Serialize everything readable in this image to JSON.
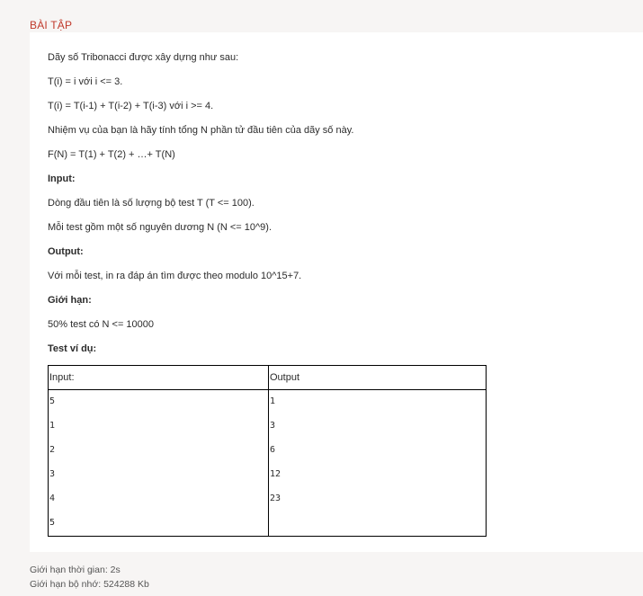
{
  "section_title": "BÀI TẬP",
  "problem": {
    "intro": "Dãy số Tribonacci được xây dựng như sau:",
    "rule1": "T(i) = i với i <= 3.",
    "rule2": "T(i) = T(i-1) + T(i-2) + T(i-3) với i >= 4.",
    "task": "Nhiệm vụ của bạn là hãy tính tổng N phần tử đầu tiên của dãy số này.",
    "formula": "F(N) = T(1) + T(2) + …+ T(N)",
    "input_heading": "Input:",
    "input_line1": "Dòng đầu tiên là số lượng bộ test T (T <= 100).",
    "input_line2": "Mỗi test gồm một số nguyên dương N (N <= 10^9).",
    "output_heading": "Output:",
    "output_line1": "Với mỗi test, in ra đáp án tìm được theo modulo 10^15+7.",
    "limit_heading": "Giới hạn:",
    "limit_line1": "50% test có N <= 10000",
    "example_heading": "Test ví dụ:",
    "example_table": {
      "header": [
        "Input:",
        "Output"
      ],
      "rows": [
        [
          "5",
          "1"
        ],
        [
          "1",
          "3"
        ],
        [
          "2",
          "6"
        ],
        [
          "3",
          "12"
        ],
        [
          "4",
          "23"
        ],
        [
          "5",
          ""
        ]
      ]
    }
  },
  "limits": {
    "time": "Giới hạn thời gian: 2s",
    "memory": "Giới hạn bộ nhớ: 524288 Kb"
  }
}
